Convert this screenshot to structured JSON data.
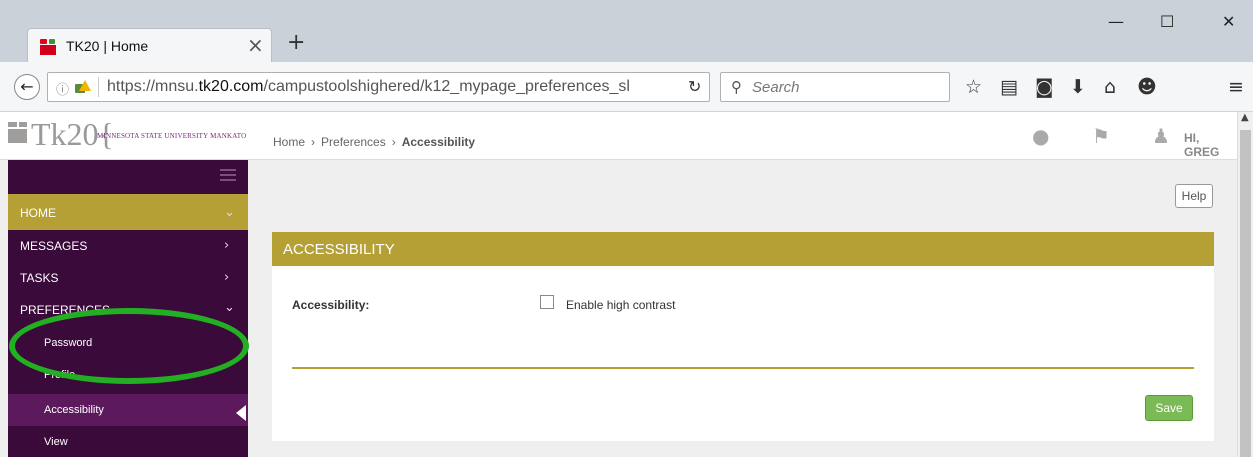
{
  "browser": {
    "tab_title": "TK20 | Home",
    "tab_close": "×",
    "new_tab": "+",
    "window_minimize": "—",
    "window_maximize": "☐",
    "window_close": "✕",
    "url_prefix": "https://mnsu.",
    "url_domain": "tk20.com",
    "url_path": "/campustoolshighered/k12_mypage_preferences_sl",
    "search_placeholder": "Search"
  },
  "header": {
    "logo_text": "Tk20{",
    "university": "MINNESOTA STATE UNIVERSITY MANKATO",
    "user_greeting": "HI, GREG"
  },
  "sidebar": {
    "home": "HOME",
    "items": [
      {
        "label": "MESSAGES"
      },
      {
        "label": "TASKS"
      },
      {
        "label": "PREFERENCES"
      }
    ],
    "subitems": [
      {
        "label": "Password"
      },
      {
        "label": "Profile"
      },
      {
        "label": "Accessibility"
      },
      {
        "label": "View"
      }
    ]
  },
  "breadcrumb": {
    "home": "Home",
    "preferences": "Preferences",
    "current": "Accessibility"
  },
  "main": {
    "help": "Help",
    "panel_title": "ACCESSIBILITY",
    "field_label": "Accessibility:",
    "checkbox_label": "Enable high contrast",
    "save": "Save"
  },
  "colors": {
    "accent_gold": "#b5a036",
    "sidebar_purple": "#3a0a3a",
    "save_green": "#7cba55",
    "highlight_ring": "#22b022"
  }
}
